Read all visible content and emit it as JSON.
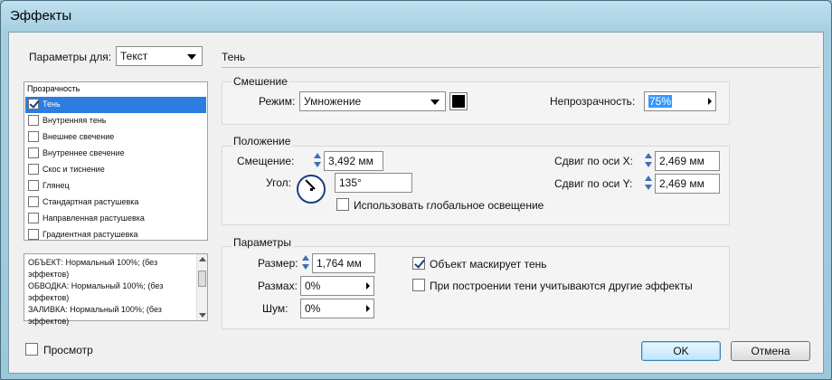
{
  "window": {
    "title": "Эффекты"
  },
  "params_for": {
    "label": "Параметры для:",
    "value": "Текст"
  },
  "effects_list": {
    "header": "Прозрачность",
    "items": [
      {
        "label": "Тень",
        "checked": true,
        "selected": true
      },
      {
        "label": "Внутренняя тень",
        "checked": false,
        "selected": false
      },
      {
        "label": "Внешнее свечение",
        "checked": false,
        "selected": false
      },
      {
        "label": "Внутреннее свечение",
        "checked": false,
        "selected": false
      },
      {
        "label": "Скос и тиснение",
        "checked": false,
        "selected": false
      },
      {
        "label": "Глянец",
        "checked": false,
        "selected": false
      },
      {
        "label": "Стандартная растушевка",
        "checked": false,
        "selected": false
      },
      {
        "label": "Направленная растушевка",
        "checked": false,
        "selected": false
      },
      {
        "label": "Градиентная растушевка",
        "checked": false,
        "selected": false
      }
    ]
  },
  "summary": {
    "lines": [
      "ОБЪЕКТ: Нормальный 100%; (без",
      "эффектов)",
      "ОБВОДКА: Нормальный 100%; (без",
      "эффектов)",
      "ЗАЛИВКА: Нормальный 100%; (без",
      "эффектов)"
    ]
  },
  "section_title": "Тень",
  "blending": {
    "title": "Смешение",
    "mode_label": "Режим:",
    "mode_value": "Умножение",
    "color": "#000000",
    "opacity_label": "Непрозрачность:",
    "opacity_value": "75%"
  },
  "position": {
    "title": "Положение",
    "distance_label": "Смещение:",
    "distance_value": "3,492 мм",
    "angle_label": "Угол:",
    "angle_value": "135°",
    "angle_degrees": 135,
    "global_light_label": "Использовать глобальное освещение",
    "global_light_checked": false,
    "x_offset_label": "Сдвиг по оси X:",
    "x_offset_value": "2,469 мм",
    "y_offset_label": "Сдвиг по оси Y:",
    "y_offset_value": "2,469 мм"
  },
  "options": {
    "title": "Параметры",
    "size_label": "Размер:",
    "size_value": "1,764 мм",
    "spread_label": "Размах:",
    "spread_value": "0%",
    "noise_label": "Шум:",
    "noise_value": "0%",
    "knocks_out_label": "Объект маскирует тень",
    "knocks_out_checked": true,
    "honor_effects_label": "При построении тени учитываются другие эффекты",
    "honor_effects_checked": false
  },
  "preview": {
    "label": "Просмотр",
    "checked": false
  },
  "buttons": {
    "ok": "OK",
    "cancel": "Отмена"
  }
}
